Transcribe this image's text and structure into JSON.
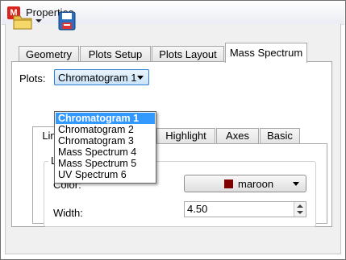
{
  "window": {
    "title": "Properties",
    "app_icon": "app-logo-icon"
  },
  "toolbar": {
    "open_icon": "folder-icon",
    "open_dropdown_icon": "dropdown-arrow-icon",
    "save_icon": "save-icon"
  },
  "tabs": [
    {
      "label": "Geometry"
    },
    {
      "label": "Plots Setup"
    },
    {
      "label": "Plots Layout"
    },
    {
      "label": "Mass Spectrum"
    }
  ],
  "plots": {
    "label": "Plots:",
    "selected": "Chromatogram 1",
    "options": [
      "Chromatogram 1",
      "Chromatogram 2",
      "Chromatogram 3",
      "Mass Spectrum 4",
      "Mass Spectrum 5",
      "UV Spectrum 6"
    ]
  },
  "inner_tabs": [
    {
      "label": "Lin"
    },
    {
      "label": "Highlight"
    },
    {
      "label": "Axes"
    },
    {
      "label": "Basic"
    }
  ],
  "line_group": {
    "title": "L",
    "color_label": "Color:",
    "color_value": "maroon",
    "color_hex": "#800000",
    "width_label": "Width:",
    "width_value": "4.50"
  }
}
